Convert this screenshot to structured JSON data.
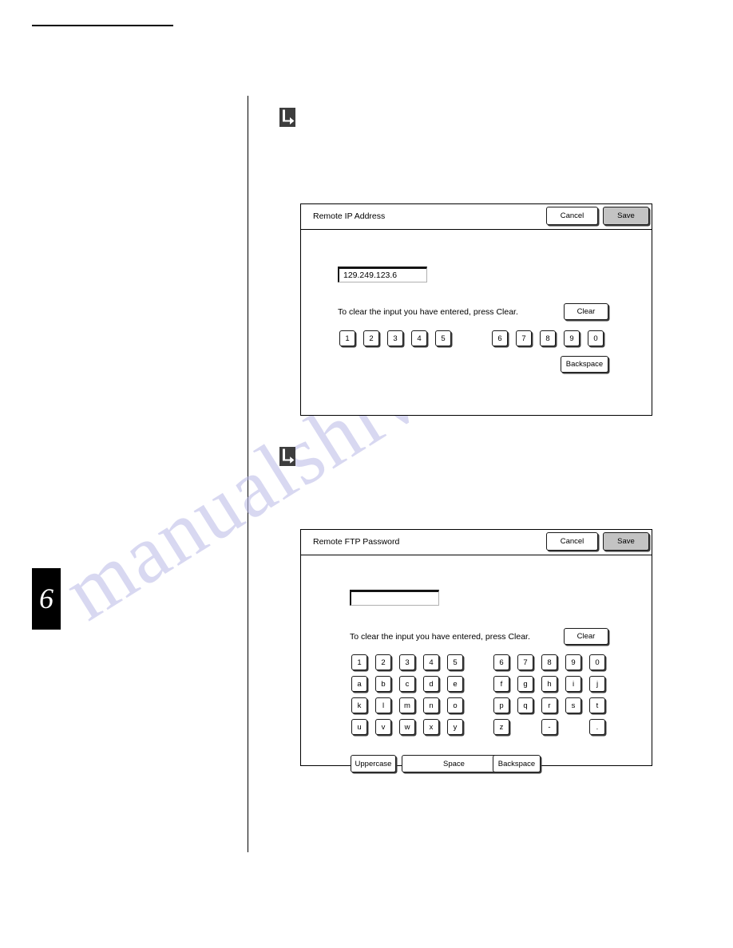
{
  "page": {
    "chapter_tab": "6",
    "watermark": "manualshive.com"
  },
  "icons": {
    "step_marker": "return-arrow-icon"
  },
  "dialogs": [
    {
      "id": "remote-ip-address",
      "title": "Remote IP Address",
      "cancel_label": "Cancel",
      "save_label": "Save",
      "input_value": "129.249.123.6",
      "input_placeholder": "",
      "hint": "To clear the input you have entered, press Clear.",
      "clear_label": "Clear",
      "backspace_label": "Backspace",
      "keys_left": [
        "1",
        "2",
        "3",
        "4",
        "5"
      ],
      "keys_right": [
        "6",
        "7",
        "8",
        "9",
        "0"
      ]
    },
    {
      "id": "remote-ftp-password",
      "title": "Remote FTP Password",
      "cancel_label": "Cancel",
      "save_label": "Save",
      "input_value": "",
      "input_placeholder": "",
      "hint": "To clear the input you have entered, press Clear.",
      "clear_label": "Clear",
      "uppercase_label": "Uppercase",
      "space_label": "Space",
      "backspace_label": "Backspace",
      "keypad_left": [
        [
          "1",
          "2",
          "3",
          "4",
          "5"
        ],
        [
          "a",
          "b",
          "c",
          "d",
          "e"
        ],
        [
          "k",
          "l",
          "m",
          "n",
          "o"
        ],
        [
          "u",
          "v",
          "w",
          "x",
          "y"
        ]
      ],
      "keypad_right": [
        [
          "6",
          "7",
          "8",
          "9",
          "0"
        ],
        [
          "f",
          "g",
          "h",
          "i",
          "j"
        ],
        [
          "p",
          "q",
          "r",
          "s",
          "t"
        ],
        [
          "z",
          "",
          "-",
          "",
          "."
        ]
      ]
    }
  ],
  "colors": {
    "primary_button_fill": "#c3c3c3",
    "border": "#000000",
    "watermark": "#b9b9e6"
  }
}
